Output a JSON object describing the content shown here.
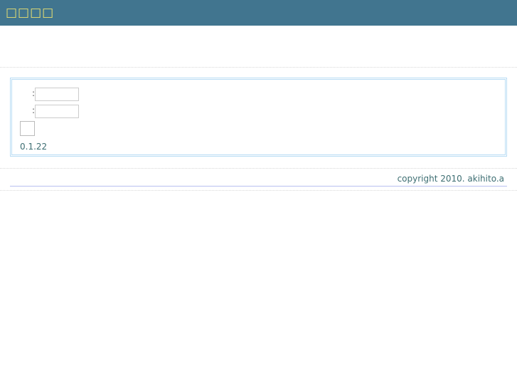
{
  "header": {
    "title": "□□□□"
  },
  "form": {
    "field1_label": ":",
    "field1_value": "",
    "field2_label": ":",
    "field2_value": "",
    "submit_label": "",
    "version": "0.1.22"
  },
  "footer": {
    "copyright": "copyright 2010. akihito.a"
  }
}
